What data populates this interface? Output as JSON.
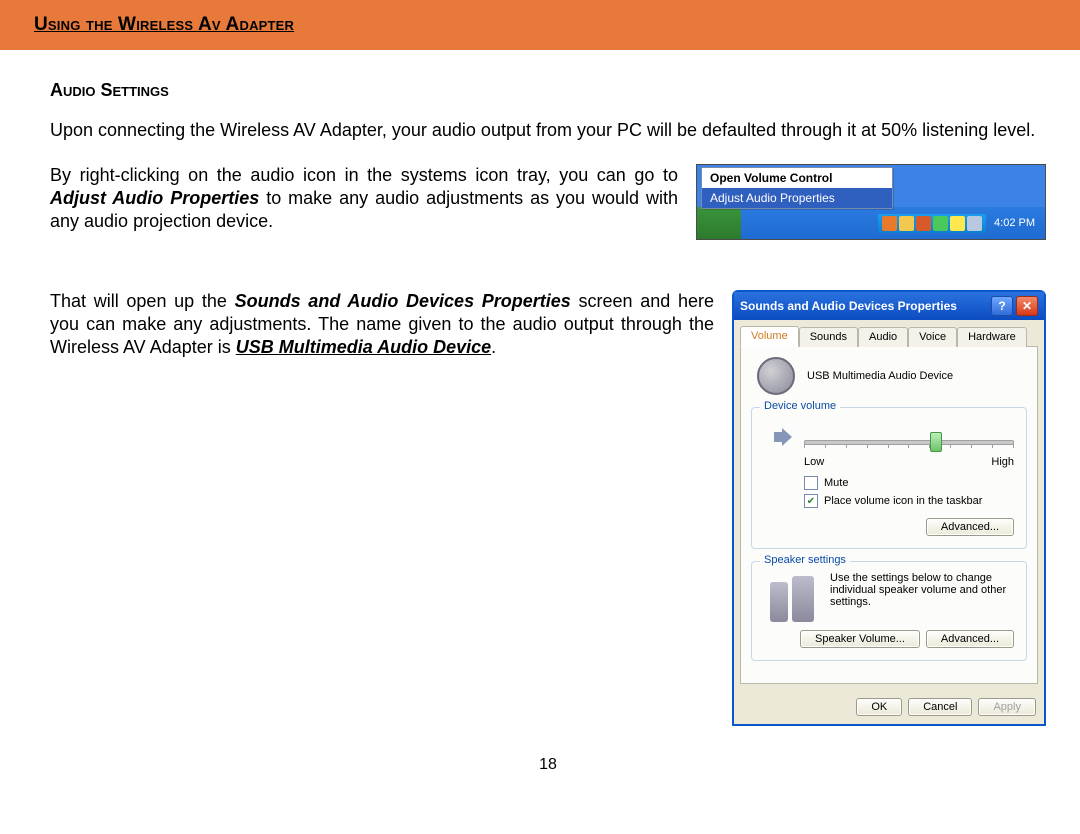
{
  "header": {
    "title": "Using the Wireless Av Adapter"
  },
  "section_heading": "Audio Settings",
  "para1": "Upon connecting the Wireless AV Adapter, your audio output from your PC will be defaulted through it at 50% listening level.",
  "para2_a": "By right-clicking on the audio icon in the systems icon tray, you can go to ",
  "para2_b": "Adjust Audio Properties",
  "para2_c": " to make any audio adjustments as you would with any audio projection device.",
  "para3_a": "That will open up the ",
  "para3_b": "Sounds and Audio Devices Properties",
  "para3_c": " screen and here you can make any adjustments.  The name given to the audio output through the Wireless AV Adapter is ",
  "para3_d": "USB Multimedia Audio Device",
  "para3_e": ".",
  "page_number": "18",
  "context_menu": {
    "item1": "Open Volume Control",
    "item2": "Adjust Audio Properties",
    "clock": "4:02 PM"
  },
  "dialog": {
    "title": "Sounds and Audio Devices Properties",
    "tabs": [
      "Volume",
      "Sounds",
      "Audio",
      "Voice",
      "Hardware"
    ],
    "device_name": "USB Multimedia Audio Device",
    "group_volume": "Device volume",
    "low": "Low",
    "high": "High",
    "mute": "Mute",
    "place_icon": "Place volume icon in the taskbar",
    "advanced": "Advanced...",
    "group_speaker": "Speaker settings",
    "speaker_text": "Use the settings below to change individual speaker volume and other settings.",
    "speaker_volume": "Speaker Volume...",
    "ok": "OK",
    "cancel": "Cancel",
    "apply": "Apply"
  }
}
